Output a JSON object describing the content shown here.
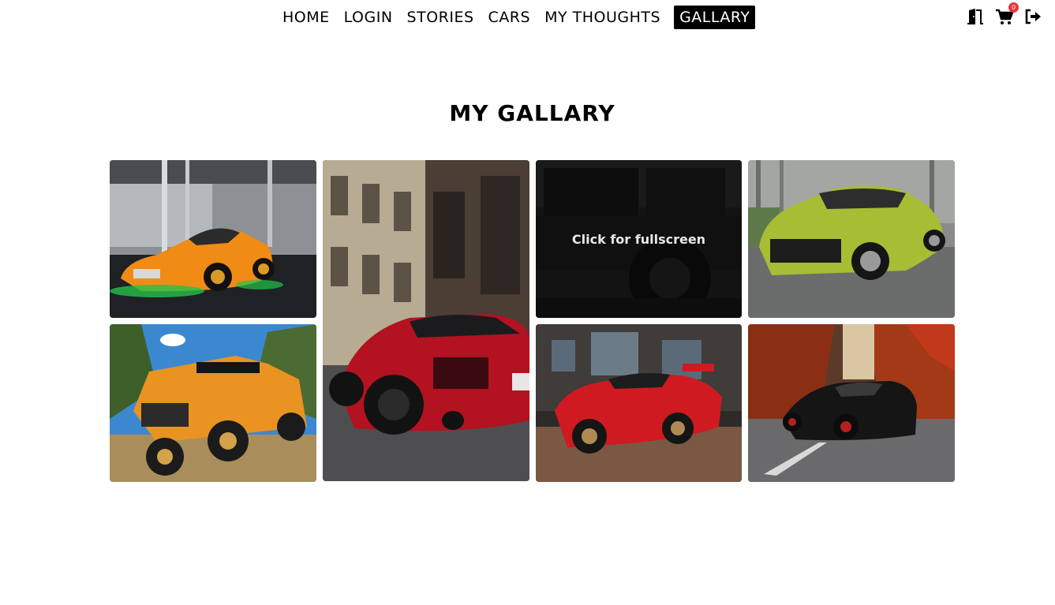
{
  "nav": {
    "links": [
      {
        "label": "HOME"
      },
      {
        "label": "LOGIN"
      },
      {
        "label": "STORIES"
      },
      {
        "label": "CARS"
      },
      {
        "label": "MY THOUGHTS"
      },
      {
        "label": "GALLARY"
      }
    ],
    "active": "GALLARY",
    "icons": [
      "door-icon",
      "cart-icon",
      "logout-icon"
    ],
    "cart_count": "0"
  },
  "title": "MY GALLARY",
  "gallery": {
    "overlay_text": "Click for fullscreen",
    "images": [
      {
        "subject": "orange sports car in warehouse"
      },
      {
        "subject": "red sports car on city street"
      },
      {
        "subject": "black off-road truck"
      },
      {
        "subject": "green muscle car on forest road"
      },
      {
        "subject": "orange off-road SUV in hills"
      },
      {
        "subject": "red race car at night"
      },
      {
        "subject": "black supercar autumn road"
      }
    ]
  },
  "colors": {
    "accent": "#000000",
    "badge": "#e8343f"
  }
}
